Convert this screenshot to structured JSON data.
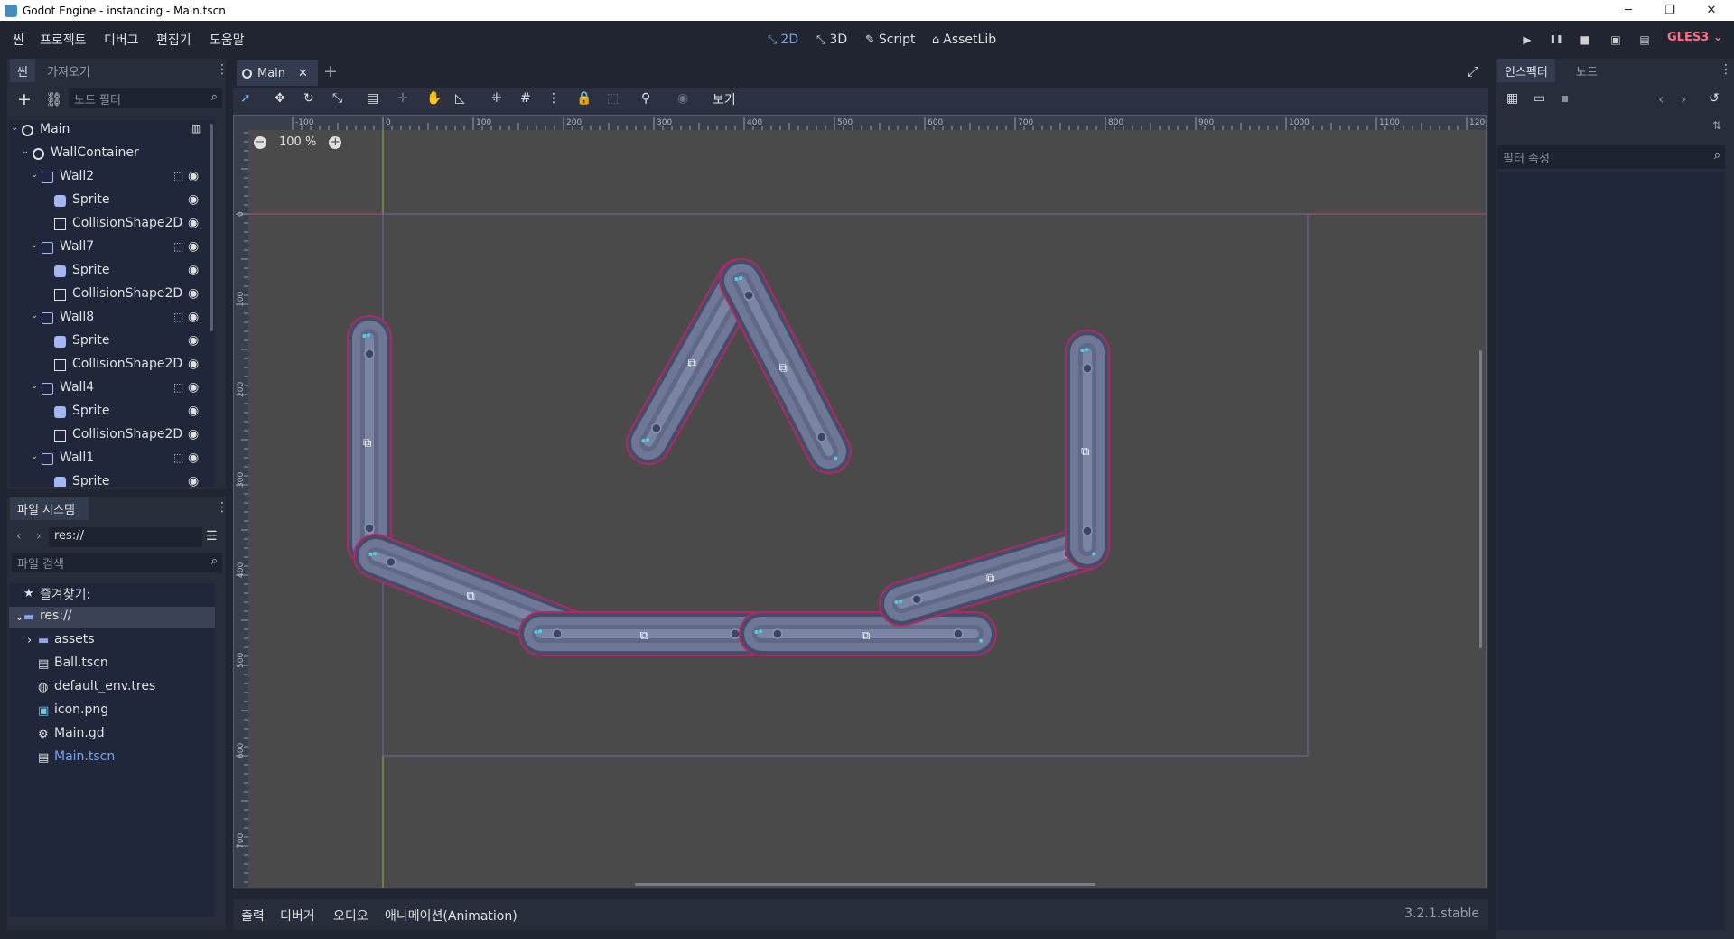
{
  "window": {
    "title": "Godot Engine - instancing - Main.tscn",
    "minimize": "─",
    "maximize": "❐",
    "close": "✕"
  },
  "menu": [
    "씬",
    "프로젝트",
    "디버그",
    "편집기",
    "도움말"
  ],
  "workspaces": [
    {
      "icon": "⤡",
      "label": "2D"
    },
    {
      "icon": "⤡",
      "label": "3D"
    },
    {
      "icon": "✎",
      "label": "Script"
    },
    {
      "icon": "⌂",
      "label": "AssetLib"
    }
  ],
  "run_buttons": [
    "▶",
    "❚❚",
    "■",
    "▣",
    "▤"
  ],
  "renderer": "GLES3 ⌄",
  "scene_dock": {
    "tabs": [
      "씬",
      "가져오기"
    ],
    "filter_placeholder": "노드 필터",
    "tree": [
      {
        "label": "Main",
        "depth": 0,
        "icon": "node",
        "arrow": "⌄",
        "script": true
      },
      {
        "label": "WallContainer",
        "depth": 1,
        "icon": "node",
        "arrow": "⌄"
      },
      {
        "label": "Wall2",
        "depth": 2,
        "icon": "body",
        "arrow": "⌄",
        "group": true,
        "eye": true
      },
      {
        "label": "Sprite",
        "depth": 3,
        "icon": "sprite",
        "eye": true
      },
      {
        "label": "CollisionShape2D",
        "depth": 3,
        "icon": "shape",
        "eye": true
      },
      {
        "label": "Wall7",
        "depth": 2,
        "icon": "body",
        "arrow": "⌄",
        "group": true,
        "eye": true
      },
      {
        "label": "Sprite",
        "depth": 3,
        "icon": "sprite",
        "eye": true
      },
      {
        "label": "CollisionShape2D",
        "depth": 3,
        "icon": "shape",
        "eye": true
      },
      {
        "label": "Wall8",
        "depth": 2,
        "icon": "body",
        "arrow": "⌄",
        "group": true,
        "eye": true
      },
      {
        "label": "Sprite",
        "depth": 3,
        "icon": "sprite",
        "eye": true
      },
      {
        "label": "CollisionShape2D",
        "depth": 3,
        "icon": "shape",
        "eye": true
      },
      {
        "label": "Wall4",
        "depth": 2,
        "icon": "body",
        "arrow": "⌄",
        "group": true,
        "eye": true
      },
      {
        "label": "Sprite",
        "depth": 3,
        "icon": "sprite",
        "eye": true
      },
      {
        "label": "CollisionShape2D",
        "depth": 3,
        "icon": "shape",
        "eye": true
      },
      {
        "label": "Wall1",
        "depth": 2,
        "icon": "body",
        "arrow": "⌄",
        "group": true,
        "eye": true
      },
      {
        "label": "Sprite",
        "depth": 3,
        "icon": "sprite",
        "eye": true
      }
    ]
  },
  "filesystem": {
    "title": "파일 시스템",
    "path": "res://",
    "search_placeholder": "파일 검색",
    "items": [
      {
        "label": "즐겨찾기:",
        "icon": "★",
        "indent": 0
      },
      {
        "label": "res://",
        "icon": "▬",
        "indent": 0,
        "selected": true
      },
      {
        "label": "assets",
        "icon": "▬",
        "indent": 1,
        "arrow": "›"
      },
      {
        "label": "Ball.tscn",
        "icon": "▤",
        "indent": 1
      },
      {
        "label": "default_env.tres",
        "icon": "◍",
        "indent": 1
      },
      {
        "label": "icon.png",
        "icon": "▣",
        "indent": 1
      },
      {
        "label": "Main.gd",
        "icon": "⚙",
        "indent": 1
      },
      {
        "label": "Main.tscn",
        "icon": "▤",
        "indent": 1,
        "highlight": true
      }
    ]
  },
  "editor_tabs": [
    {
      "label": "Main",
      "close": "✕"
    }
  ],
  "add_tab": "+",
  "viewport_menu": "보기",
  "zoom": {
    "value": "100 %",
    "minus": "−",
    "plus": "+"
  },
  "ruler": {
    "x_labels": [
      "-100",
      "0",
      "100",
      "200",
      "300",
      "400",
      "500",
      "600",
      "700",
      "800",
      "900",
      "1000",
      "1100",
      "1200"
    ],
    "y_labels": [
      "0",
      "100",
      "200",
      "300",
      "400",
      "500",
      "600",
      "700"
    ]
  },
  "bottom_tabs": [
    "출력",
    "디버거",
    "오디오",
    "애니메이션(Animation)"
  ],
  "version": "3.2.1.stable",
  "inspector": {
    "tabs": [
      "인스펙터",
      "노드"
    ],
    "filter_placeholder": "필터 속성"
  },
  "colors": {
    "accent": "#74a5e8",
    "renderer": "#ff7085",
    "wall": "#6e7796",
    "wall_edge": "#454c6a"
  }
}
